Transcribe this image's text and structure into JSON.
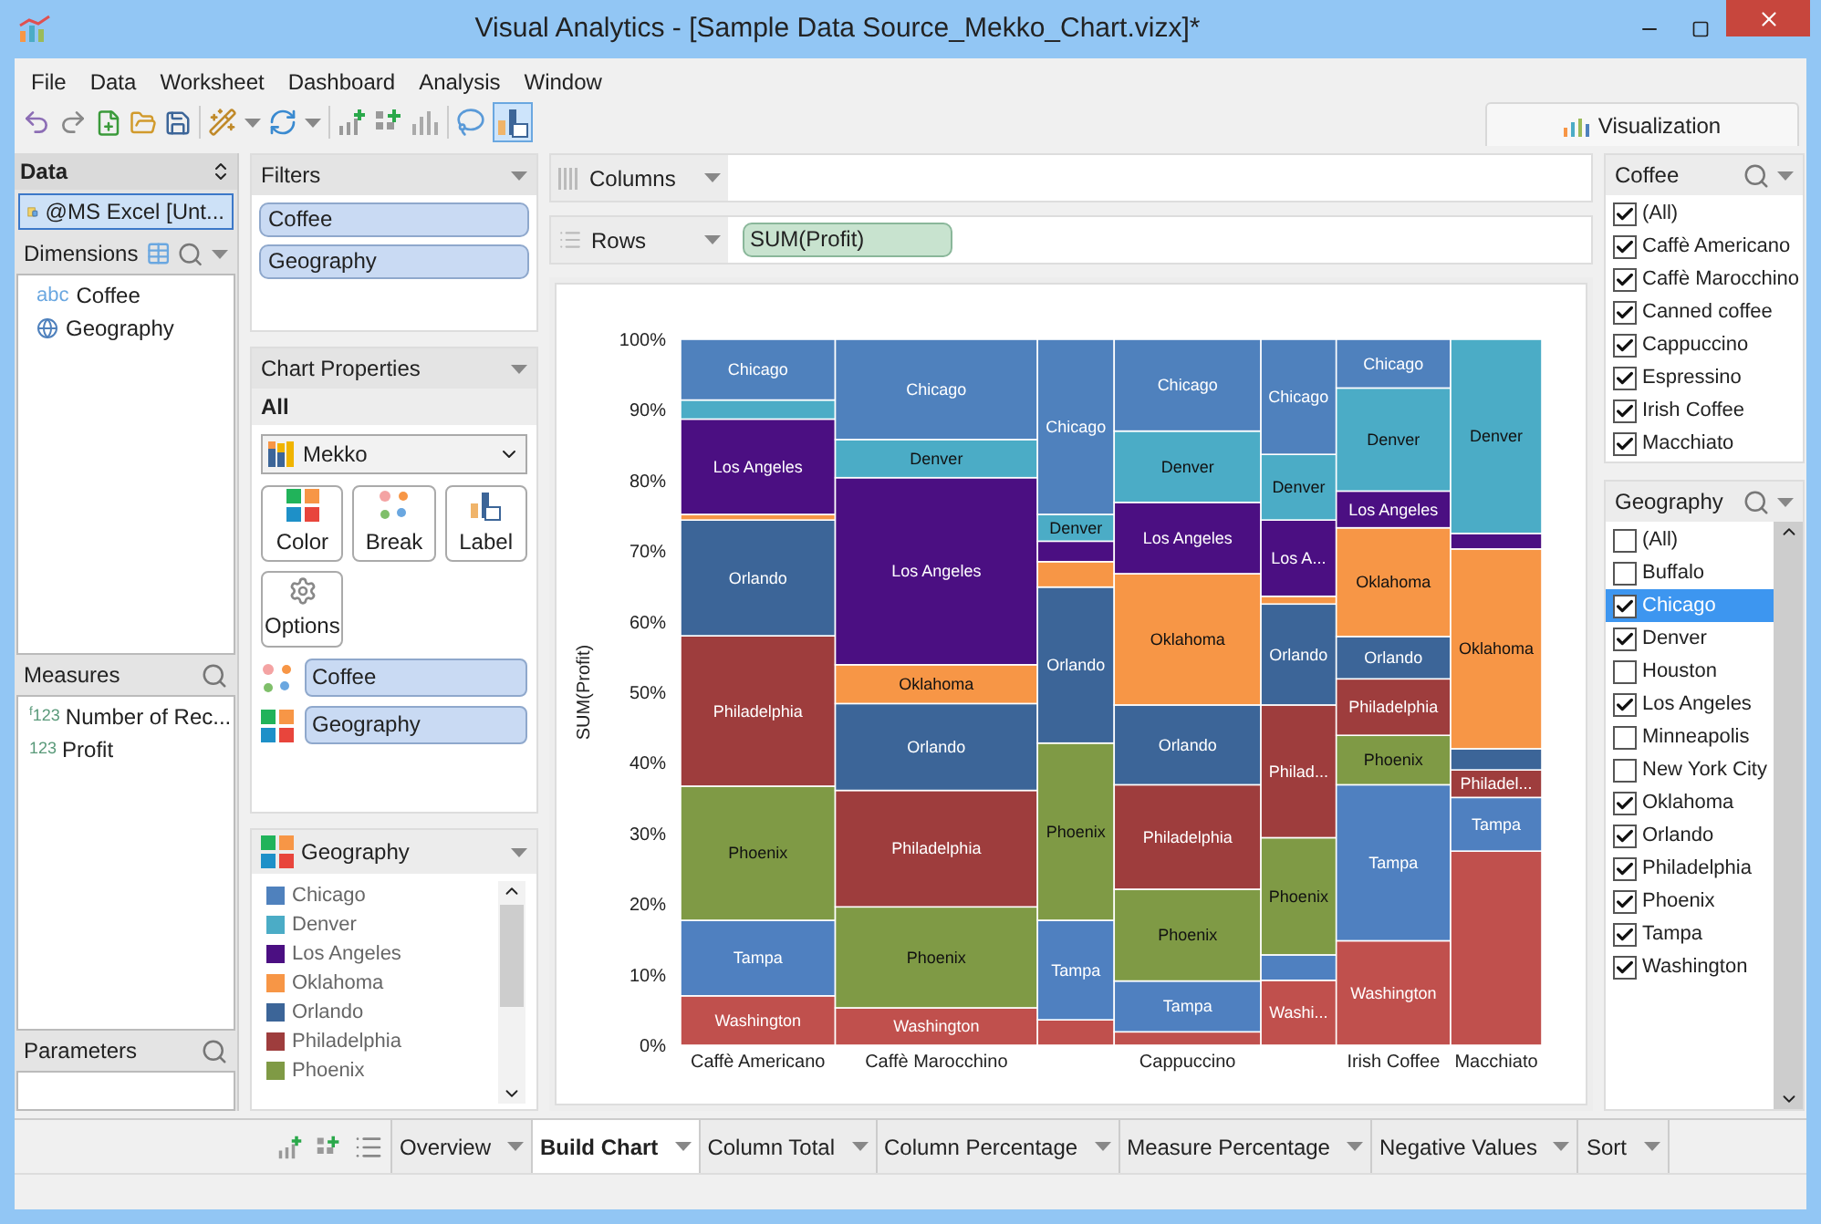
{
  "window": {
    "title": "Visual Analytics - [Sample Data Source_Mekko_Chart.vizx]*"
  },
  "menu": [
    "File",
    "Data",
    "Worksheet",
    "Dashboard",
    "Analysis",
    "Window"
  ],
  "toolbar": {
    "visualization_tab": "Visualization"
  },
  "data_panel": {
    "title": "Data",
    "source": {
      "label": "@MS Excel [Unt...",
      "selected": true
    },
    "dimensions": {
      "title": "Dimensions",
      "items": [
        {
          "kind": "text",
          "type_icon": "abc",
          "label": "Coffee"
        },
        {
          "kind": "geo",
          "label": "Geography"
        }
      ]
    },
    "measures": {
      "title": "Measures",
      "items": [
        {
          "kind": "number",
          "type_icon": "$^{f}$123",
          "label": "Number of Rec..."
        },
        {
          "kind": "number",
          "type_icon": "123",
          "label": "Profit"
        }
      ]
    },
    "parameters": {
      "title": "Parameters"
    }
  },
  "filters": {
    "title": "Filters",
    "pills": [
      "Coffee",
      "Geography"
    ]
  },
  "chart_properties": {
    "title": "Chart Properties",
    "scope": "All",
    "chart_type": "Mekko",
    "buttons": [
      {
        "kind": "color",
        "label": "Color"
      },
      {
        "kind": "break",
        "label": "Break"
      },
      {
        "kind": "label",
        "label": "Label"
      },
      {
        "kind": "options",
        "label": "Options"
      }
    ],
    "shelves": [
      {
        "kind": "break",
        "pill": "Coffee"
      },
      {
        "kind": "color",
        "pill": "Geography"
      }
    ]
  },
  "legend": {
    "title": "Geography",
    "items": [
      {
        "label": "Chicago",
        "color": "#4f81bd"
      },
      {
        "label": "Denver",
        "color": "#4bacc6"
      },
      {
        "label": "Los Angeles",
        "color": "#4b0f82"
      },
      {
        "label": "Oklahoma",
        "color": "#f79646"
      },
      {
        "label": "Orlando",
        "color": "#3c6598"
      },
      {
        "label": "Philadelphia",
        "color": "#9e3d3d"
      },
      {
        "label": "Phoenix",
        "color": "#7f9a45"
      }
    ]
  },
  "shelves": {
    "columns": {
      "label": "Columns"
    },
    "rows": {
      "label": "Rows",
      "pills": [
        "SUM(Profit)"
      ]
    }
  },
  "chart": {
    "chart_data": {
      "type": "bar",
      "stacked": true,
      "ylabel": "SUM(Profit)",
      "categories": [
        "Caffè Americano",
        "Caffè Marocchino",
        null,
        "Cappuccino",
        null,
        "Irish Coffee",
        "Macchiato"
      ],
      "ylim": [
        0,
        100
      ],
      "yticks": [
        {
          "value": 0,
          "label": "0%"
        },
        {
          "value": 10,
          "label": "10%"
        },
        {
          "value": 20,
          "label": "20%"
        },
        {
          "value": 30,
          "label": "30%"
        },
        {
          "value": 40,
          "label": "40%"
        },
        {
          "value": 50,
          "label": "50%"
        },
        {
          "value": 60,
          "label": "60%"
        },
        {
          "value": 70,
          "label": "70%"
        },
        {
          "value": 80,
          "label": "80%"
        },
        {
          "value": 90,
          "label": "90%"
        },
        {
          "value": 100,
          "label": "100%"
        }
      ],
      "series": [
        {
          "name": "Chicago",
          "color": "#4f81bd",
          "values": [
            8.6,
            14.2,
            24.8,
            13.0,
            16.3,
            6.9,
            0
          ],
          "value_labels": [
            null,
            null,
            null,
            null,
            null,
            null,
            null
          ]
        },
        {
          "name": "Denver",
          "color": "#4bacc6",
          "values": [
            2.7,
            5.4,
            3.8,
            10.1,
            9.3,
            14.6,
            27.5
          ],
          "value_labels": [
            null,
            null,
            null,
            null,
            null,
            null,
            null
          ]
        },
        {
          "name": "Los Angeles",
          "color": "#4b0f82",
          "values": [
            13.5,
            26.5,
            2.9,
            10.1,
            10.8,
            5.2,
            2.2
          ],
          "value_labels": [
            null,
            null,
            null,
            null,
            "Los A...",
            null,
            null
          ]
        },
        {
          "name": "Oklahoma",
          "color": "#f79646",
          "values": [
            0.8,
            5.5,
            3.6,
            18.6,
            1.1,
            15.4,
            28.3
          ],
          "value_labels": [
            null,
            null,
            null,
            null,
            null,
            null,
            null
          ]
        },
        {
          "name": "Orlando",
          "color": "#3c6598",
          "values": [
            16.4,
            12.3,
            22.1,
            11.3,
            14.3,
            6.0,
            3.0
          ],
          "value_labels": [
            null,
            null,
            null,
            null,
            null,
            null,
            null
          ]
        },
        {
          "name": "Philadelphia",
          "color": "#9e3d3d",
          "values": [
            21.3,
            16.5,
            0,
            14.8,
            18.8,
            8.0,
            3.9
          ],
          "value_labels": [
            null,
            null,
            null,
            null,
            "Philad...",
            null,
            "Philadel..."
          ]
        },
        {
          "name": "Phoenix",
          "color": "#7f9a45",
          "values": [
            19.0,
            14.3,
            25.1,
            13.0,
            16.6,
            7.0,
            0
          ],
          "value_labels": [
            null,
            null,
            null,
            null,
            null,
            null,
            null
          ]
        },
        {
          "name": "Tampa",
          "color": "#4f80c0",
          "values": [
            10.7,
            0,
            14.1,
            7.2,
            3.6,
            22.1,
            7.6
          ],
          "value_labels": [
            null,
            null,
            null,
            null,
            null,
            null,
            null
          ]
        },
        {
          "name": "Washington",
          "color": "#c0504d",
          "values": [
            7.0,
            5.3,
            3.6,
            1.9,
            9.2,
            14.8,
            27.5
          ],
          "value_labels": [
            null,
            null,
            null,
            null,
            "Washi...",
            null,
            false
          ]
        }
      ]
    }
  },
  "quick_filters": [
    {
      "title": "Coffee",
      "scrollable": false,
      "items": [
        {
          "label": "(All)",
          "checked": true,
          "selected": false
        },
        {
          "label": "Caffè Americano",
          "checked": true,
          "selected": false
        },
        {
          "label": "Caffè Marocchino",
          "checked": true,
          "selected": false
        },
        {
          "label": "Canned coffee",
          "checked": true,
          "selected": false
        },
        {
          "label": "Cappuccino",
          "checked": true,
          "selected": false
        },
        {
          "label": "Espressino",
          "checked": true,
          "selected": false
        },
        {
          "label": "Irish Coffee",
          "checked": true,
          "selected": false
        },
        {
          "label": "Macchiato",
          "checked": true,
          "selected": false
        }
      ]
    },
    {
      "title": "Geography",
      "scrollable": true,
      "items": [
        {
          "label": "(All)",
          "checked": false,
          "selected": false
        },
        {
          "label": "Buffalo",
          "checked": false,
          "selected": false
        },
        {
          "label": "Chicago",
          "checked": true,
          "selected": true
        },
        {
          "label": "Denver",
          "checked": true,
          "selected": false
        },
        {
          "label": "Houston",
          "checked": false,
          "selected": false
        },
        {
          "label": "Los Angeles",
          "checked": true,
          "selected": false
        },
        {
          "label": "Minneapolis",
          "checked": false,
          "selected": false
        },
        {
          "label": "New York City",
          "checked": false,
          "selected": false
        },
        {
          "label": "Oklahoma",
          "checked": true,
          "selected": false
        },
        {
          "label": "Orlando",
          "checked": true,
          "selected": false
        },
        {
          "label": "Philadelphia",
          "checked": true,
          "selected": false
        },
        {
          "label": "Phoenix",
          "checked": true,
          "selected": false
        },
        {
          "label": "Tampa",
          "checked": true,
          "selected": false
        },
        {
          "label": "Washington",
          "checked": true,
          "selected": false
        }
      ]
    }
  ],
  "sheet_tabs": [
    {
      "label": "Overview",
      "selected": false
    },
    {
      "label": "Build Chart",
      "selected": true
    },
    {
      "label": "Column Total",
      "selected": false
    },
    {
      "label": "Column Percentage",
      "selected": false
    },
    {
      "label": "Measure Percentage",
      "selected": false
    },
    {
      "label": "Negative Values",
      "selected": false
    },
    {
      "label": "Sort",
      "selected": false
    }
  ]
}
